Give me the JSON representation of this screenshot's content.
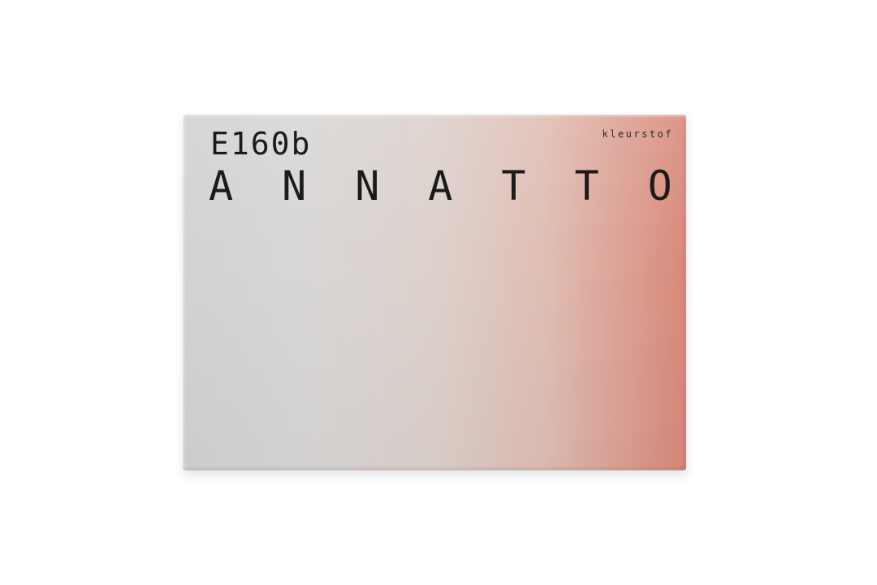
{
  "card": {
    "code": "E160b",
    "name": "ANNATTO",
    "brand": "kleurstof",
    "colors": {
      "gradient_start": "#d2d2d4",
      "gradient_mid": "#ddd1cc",
      "gradient_end": "#d98a7b",
      "text": "#1b1b1b",
      "background": "#ffffff"
    }
  }
}
